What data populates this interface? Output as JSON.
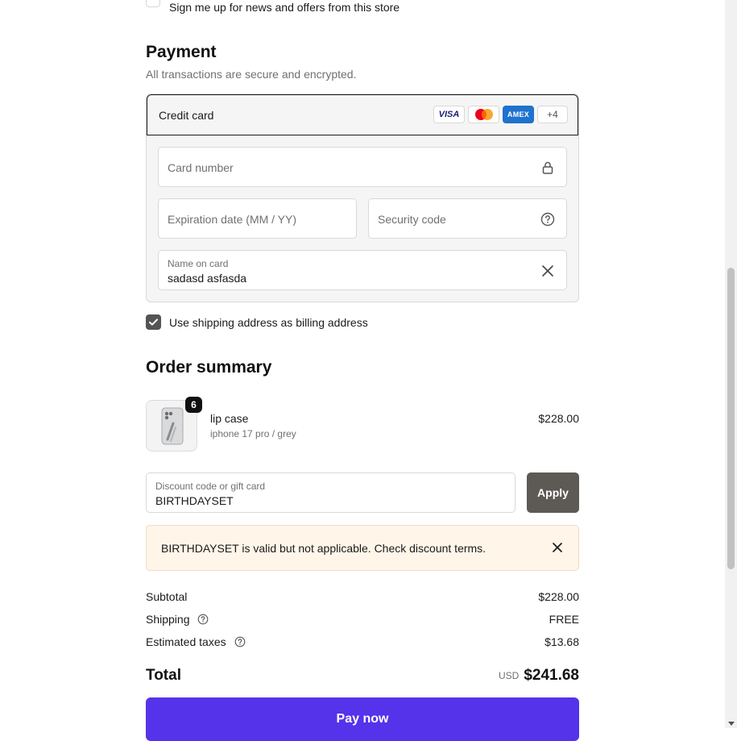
{
  "newsletter": {
    "label": "Sign me up for news and offers from this store",
    "checked": false
  },
  "payment": {
    "title": "Payment",
    "subtitle": "All transactions are secure and encrypted.",
    "method_label": "Credit card",
    "brands": [
      "VISA",
      "mastercard",
      "AMEX",
      "+4"
    ],
    "card_number_placeholder": "Card number",
    "expiry_placeholder": "Expiration date (MM / YY)",
    "security_placeholder": "Security code",
    "name_label": "Name on card",
    "name_value": "sadasd asfasda"
  },
  "billing": {
    "label": "Use shipping address as billing address",
    "checked": true
  },
  "summary": {
    "title": "Order summary",
    "item": {
      "quantity": "6",
      "name": "lip case",
      "variant": "iphone 17 pro / grey",
      "price": "$228.00"
    },
    "discount": {
      "label": "Discount code or gift card",
      "value": "BIRTHDAYSET",
      "apply_label": "Apply"
    },
    "notice": "BIRTHDAYSET is valid but not applicable. Check discount terms.",
    "subtotal_label": "Subtotal",
    "subtotal_value": "$228.00",
    "shipping_label": "Shipping",
    "shipping_value": "FREE",
    "taxes_label": "Estimated taxes",
    "taxes_value": "$13.68",
    "total_label": "Total",
    "total_currency": "USD",
    "total_value": "$241.68",
    "pay_label": "Pay now"
  },
  "colors": {
    "pay_button": "#5433eb",
    "apply_button": "#5d5955",
    "notice_bg": "#fff5e9"
  },
  "icons": [
    "lock-icon",
    "help-circle-icon",
    "close-icon",
    "check-icon"
  ]
}
